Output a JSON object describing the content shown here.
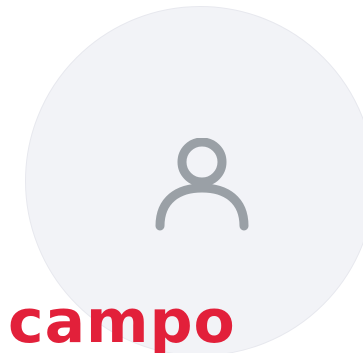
{
  "avatar": {
    "icon": "user-icon",
    "background_color": "#f2f3f7",
    "icon_color": "#9aa0a6"
  },
  "brand": {
    "text": "campo",
    "color": "#e2203a"
  }
}
